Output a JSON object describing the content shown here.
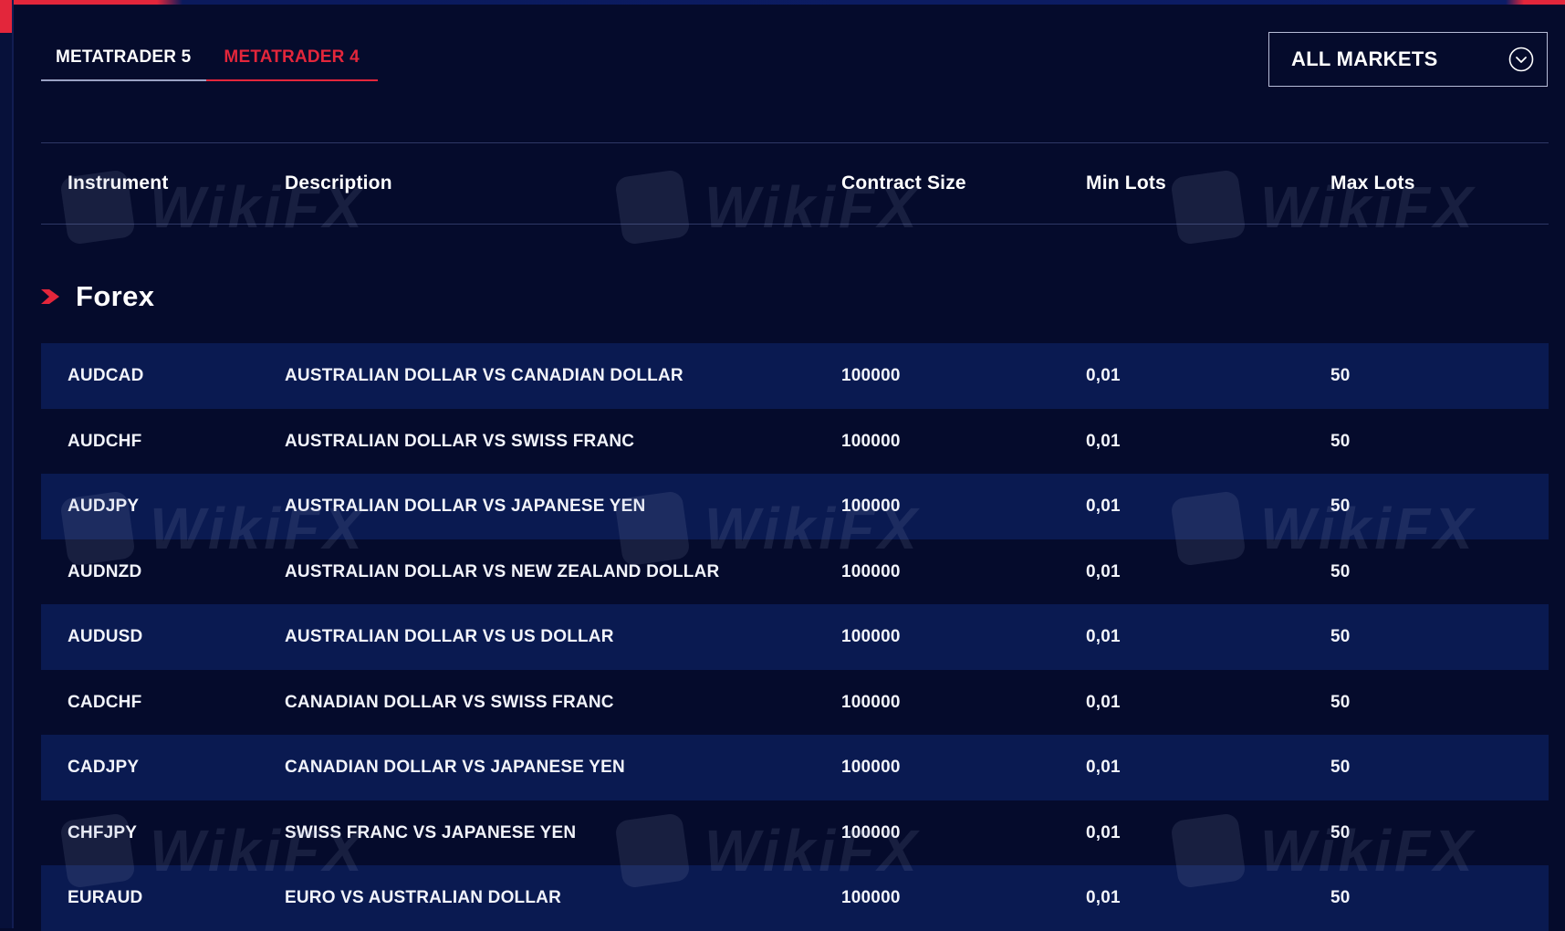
{
  "tabs": [
    {
      "label": "METATRADER 5",
      "active": false
    },
    {
      "label": "METATRADER 4",
      "active": true
    }
  ],
  "market_filter": {
    "selected": "ALL MARKETS",
    "icon": "chevron-down-circle-icon"
  },
  "table": {
    "headers": {
      "instrument": "Instrument",
      "description": "Description",
      "contract_size": "Contract Size",
      "min_lots": "Min Lots",
      "max_lots": "Max Lots"
    }
  },
  "section": {
    "title": "Forex",
    "icon": "chevron-right-icon",
    "rows": [
      {
        "instrument": "AUDCAD",
        "description": "AUSTRALIAN DOLLAR VS CANADIAN DOLLAR",
        "contract_size": "100000",
        "min_lots": "0,01",
        "max_lots": "50"
      },
      {
        "instrument": "AUDCHF",
        "description": "AUSTRALIAN DOLLAR VS SWISS FRANC",
        "contract_size": "100000",
        "min_lots": "0,01",
        "max_lots": "50"
      },
      {
        "instrument": "AUDJPY",
        "description": "AUSTRALIAN DOLLAR VS JAPANESE YEN",
        "contract_size": "100000",
        "min_lots": "0,01",
        "max_lots": "50"
      },
      {
        "instrument": "AUDNZD",
        "description": "AUSTRALIAN DOLLAR VS NEW ZEALAND DOLLAR",
        "contract_size": "100000",
        "min_lots": "0,01",
        "max_lots": "50"
      },
      {
        "instrument": "AUDUSD",
        "description": "AUSTRALIAN DOLLAR VS US DOLLAR",
        "contract_size": "100000",
        "min_lots": "0,01",
        "max_lots": "50"
      },
      {
        "instrument": "CADCHF",
        "description": "CANADIAN DOLLAR VS SWISS FRANC",
        "contract_size": "100000",
        "min_lots": "0,01",
        "max_lots": "50"
      },
      {
        "instrument": "CADJPY",
        "description": "CANADIAN DOLLAR VS JAPANESE YEN",
        "contract_size": "100000",
        "min_lots": "0,01",
        "max_lots": "50"
      },
      {
        "instrument": "CHFJPY",
        "description": "SWISS FRANC VS JAPANESE YEN",
        "contract_size": "100000",
        "min_lots": "0,01",
        "max_lots": "50"
      },
      {
        "instrument": "EURAUD",
        "description": "EURO VS AUSTRALIAN DOLLAR",
        "contract_size": "100000",
        "min_lots": "0,01",
        "max_lots": "50"
      }
    ]
  },
  "watermark": {
    "text": "WikiFX"
  },
  "colors": {
    "background": "#050b2c",
    "row_shade": "#0a1a51",
    "accent": "#e3263b",
    "text": "#ffffff"
  }
}
